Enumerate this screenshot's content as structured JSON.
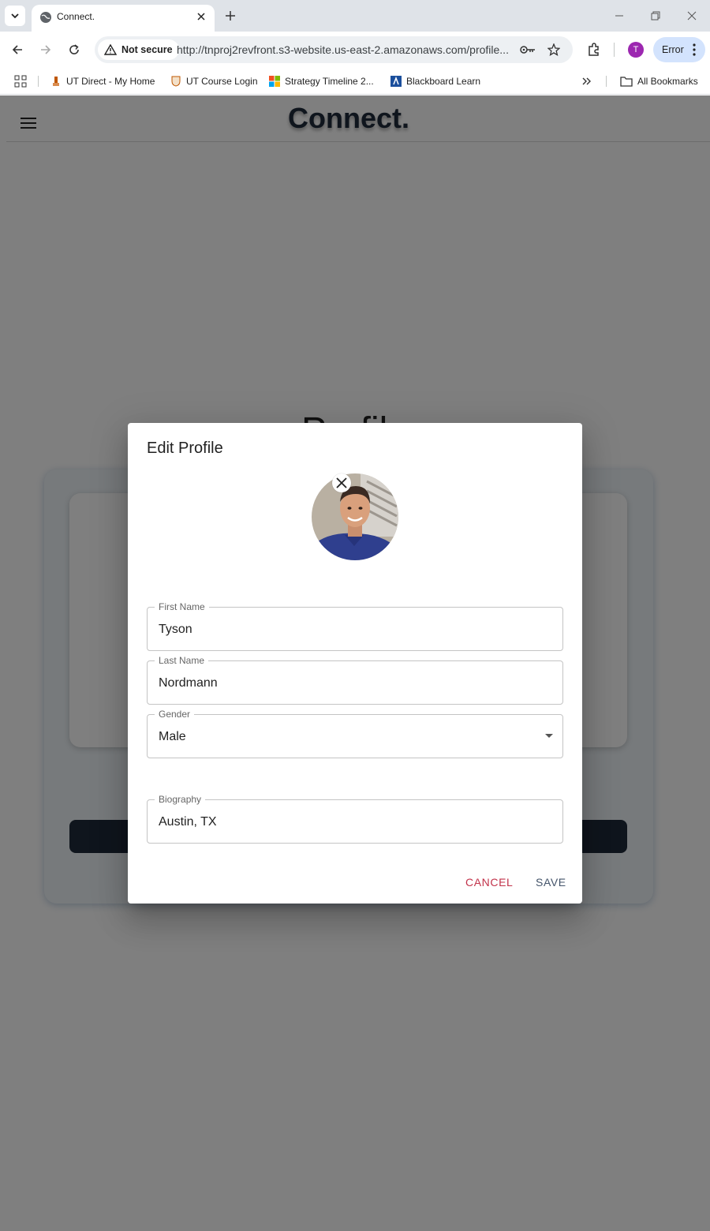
{
  "browser": {
    "tab_title": "Connect.",
    "security_label": "Not secure",
    "url": "http://tnproj2revfront.s3-website.us-east-2.amazonaws.com/profile...",
    "profile_initial": "T",
    "error_label": "Error",
    "bookmarks": [
      "UT Direct - My Home",
      "UT Course Login",
      "Strategy Timeline 2...",
      "Blackboard Learn"
    ],
    "all_bookmarks_label": "All Bookmarks"
  },
  "app": {
    "brand": "Connect.",
    "page_heading": "Profile"
  },
  "dialog": {
    "title": "Edit Profile",
    "fields": [
      {
        "label": "First Name",
        "value": "Tyson"
      },
      {
        "label": "Last Name",
        "value": "Nordmann"
      },
      {
        "label": "Gender",
        "value": "Male"
      },
      {
        "label": "Biography",
        "value": "Austin, TX"
      }
    ],
    "cancel_label": "CANCEL",
    "save_label": "SAVE"
  },
  "colors": {
    "brand_dark": "#1e2a3a",
    "cancel": "#c2324a",
    "avatar_chip": "#9c27b0",
    "error_chip": "#d3e3fd"
  }
}
